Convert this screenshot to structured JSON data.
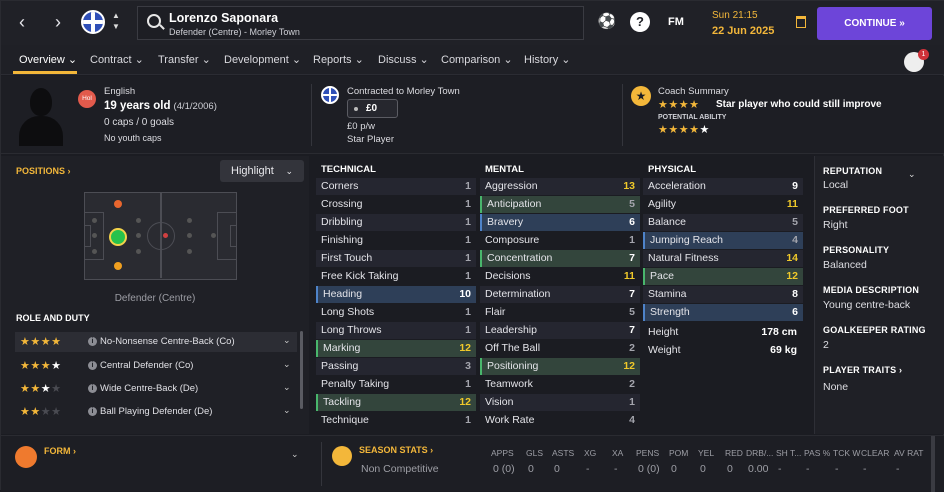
{
  "topbar": {
    "player_name": "Lorenzo Saponara",
    "player_subtitle": "Defender (Centre) - Morley Town",
    "fm_label": "FM",
    "help_label": "?",
    "date_time": "Sun 21:15",
    "date_day": "22 Jun 2025",
    "continue_label": "CONTINUE »",
    "nav_back": "‹",
    "nav_forward": "›"
  },
  "tabs": [
    {
      "label": "Overview ⌄"
    },
    {
      "label": "Contract ⌄"
    },
    {
      "label": "Transfer ⌄"
    },
    {
      "label": "Development ⌄"
    },
    {
      "label": "Reports ⌄"
    },
    {
      "label": "Discuss ⌄"
    },
    {
      "label": "Comparison ⌄"
    },
    {
      "label": "History ⌄"
    }
  ],
  "notifications": {
    "count": "1"
  },
  "header": {
    "flag_code": "Hol",
    "nationality": "English",
    "age": "19 years old",
    "dob": "(4/1/2006)",
    "caps": "0 caps / 0 goals",
    "youth_caps": "No youth caps",
    "contract_label": "Contracted to Morley Town",
    "wage_value": "£0",
    "wage_pw": "£0 p/w",
    "player_status": "Star Player",
    "coach_summary_label": "Coach Summary",
    "coach_summary_text": "Star player who could still improve",
    "potential_label": "POTENTIAL ABILITY",
    "current_stars": 4,
    "potential_stars": 4.5
  },
  "positions": {
    "title": "POSITIONS ›",
    "highlight_label": "Highlight",
    "position_label": "Defender (Centre)"
  },
  "roles": {
    "title": "ROLE AND DUTY",
    "items": [
      {
        "name": "No-Nonsense Centre-Back (Co)",
        "stars": 4
      },
      {
        "name": "Central Defender (Co)",
        "stars": 3.5
      },
      {
        "name": "Wide Centre-Back (De)",
        "stars": 2.5
      },
      {
        "name": "Ball Playing Defender (De)",
        "stars": 2
      }
    ]
  },
  "technical": {
    "title": "TECHNICAL",
    "items": [
      {
        "name": "Corners",
        "value": "1"
      },
      {
        "name": "Crossing",
        "value": "1"
      },
      {
        "name": "Dribbling",
        "value": "1"
      },
      {
        "name": "Finishing",
        "value": "1"
      },
      {
        "name": "First Touch",
        "value": "1"
      },
      {
        "name": "Free Kick Taking",
        "value": "1"
      },
      {
        "name": "Heading",
        "value": "10"
      },
      {
        "name": "Long Shots",
        "value": "1"
      },
      {
        "name": "Long Throws",
        "value": "1"
      },
      {
        "name": "Marking",
        "value": "12"
      },
      {
        "name": "Passing",
        "value": "3"
      },
      {
        "name": "Penalty Taking",
        "value": "1"
      },
      {
        "name": "Tackling",
        "value": "12"
      },
      {
        "name": "Technique",
        "value": "1"
      }
    ]
  },
  "mental": {
    "title": "MENTAL",
    "items": [
      {
        "name": "Aggression",
        "value": "13"
      },
      {
        "name": "Anticipation",
        "value": "5"
      },
      {
        "name": "Bravery",
        "value": "6"
      },
      {
        "name": "Composure",
        "value": "1"
      },
      {
        "name": "Concentration",
        "value": "7"
      },
      {
        "name": "Decisions",
        "value": "11"
      },
      {
        "name": "Determination",
        "value": "7"
      },
      {
        "name": "Flair",
        "value": "5"
      },
      {
        "name": "Leadership",
        "value": "7"
      },
      {
        "name": "Off The Ball",
        "value": "2"
      },
      {
        "name": "Positioning",
        "value": "12"
      },
      {
        "name": "Teamwork",
        "value": "2"
      },
      {
        "name": "Vision",
        "value": "1"
      },
      {
        "name": "Work Rate",
        "value": "4"
      }
    ]
  },
  "physical": {
    "title": "PHYSICAL",
    "items": [
      {
        "name": "Acceleration",
        "value": "9"
      },
      {
        "name": "Agility",
        "value": "11"
      },
      {
        "name": "Balance",
        "value": "5"
      },
      {
        "name": "Jumping Reach",
        "value": "4"
      },
      {
        "name": "Natural Fitness",
        "value": "14"
      },
      {
        "name": "Pace",
        "value": "12"
      },
      {
        "name": "Stamina",
        "value": "8"
      },
      {
        "name": "Strength",
        "value": "6"
      }
    ],
    "height_label": "Height",
    "height_value": "178 cm",
    "weight_label": "Weight",
    "weight_value": "69 kg"
  },
  "side_info": {
    "reputation_title": "REPUTATION",
    "reputation_value": "Local",
    "foot_title": "PREFERRED FOOT",
    "foot_value": "Right",
    "personality_title": "PERSONALITY",
    "personality_value": "Balanced",
    "media_title": "MEDIA DESCRIPTION",
    "media_value": "Young centre-back",
    "gk_title": "GOALKEEPER RATING",
    "gk_value": "2",
    "traits_title": "PLAYER TRAITS ›",
    "traits_value": "None"
  },
  "form": {
    "title": "FORM ›"
  },
  "season_stats": {
    "title": "SEASON STATS ›",
    "subtitle": "Non Competitive",
    "columns": [
      "APPS",
      "GLS",
      "ASTS",
      "XG",
      "XA",
      "PENS",
      "POM",
      "YEL",
      "RED",
      "DRB/...",
      "SH T...",
      "PAS %",
      "TCK W",
      "CLEAR",
      "AV RAT"
    ],
    "values": [
      "0 (0)",
      "0",
      "0",
      "-",
      "-",
      "0 (0)",
      "0",
      "0",
      "0",
      "0.00",
      "-",
      "-",
      "-",
      "-",
      "-"
    ]
  },
  "colors": {
    "accent": "#f3b73a",
    "continue": "#6d45d9",
    "high_attr": "#f0c92a"
  }
}
